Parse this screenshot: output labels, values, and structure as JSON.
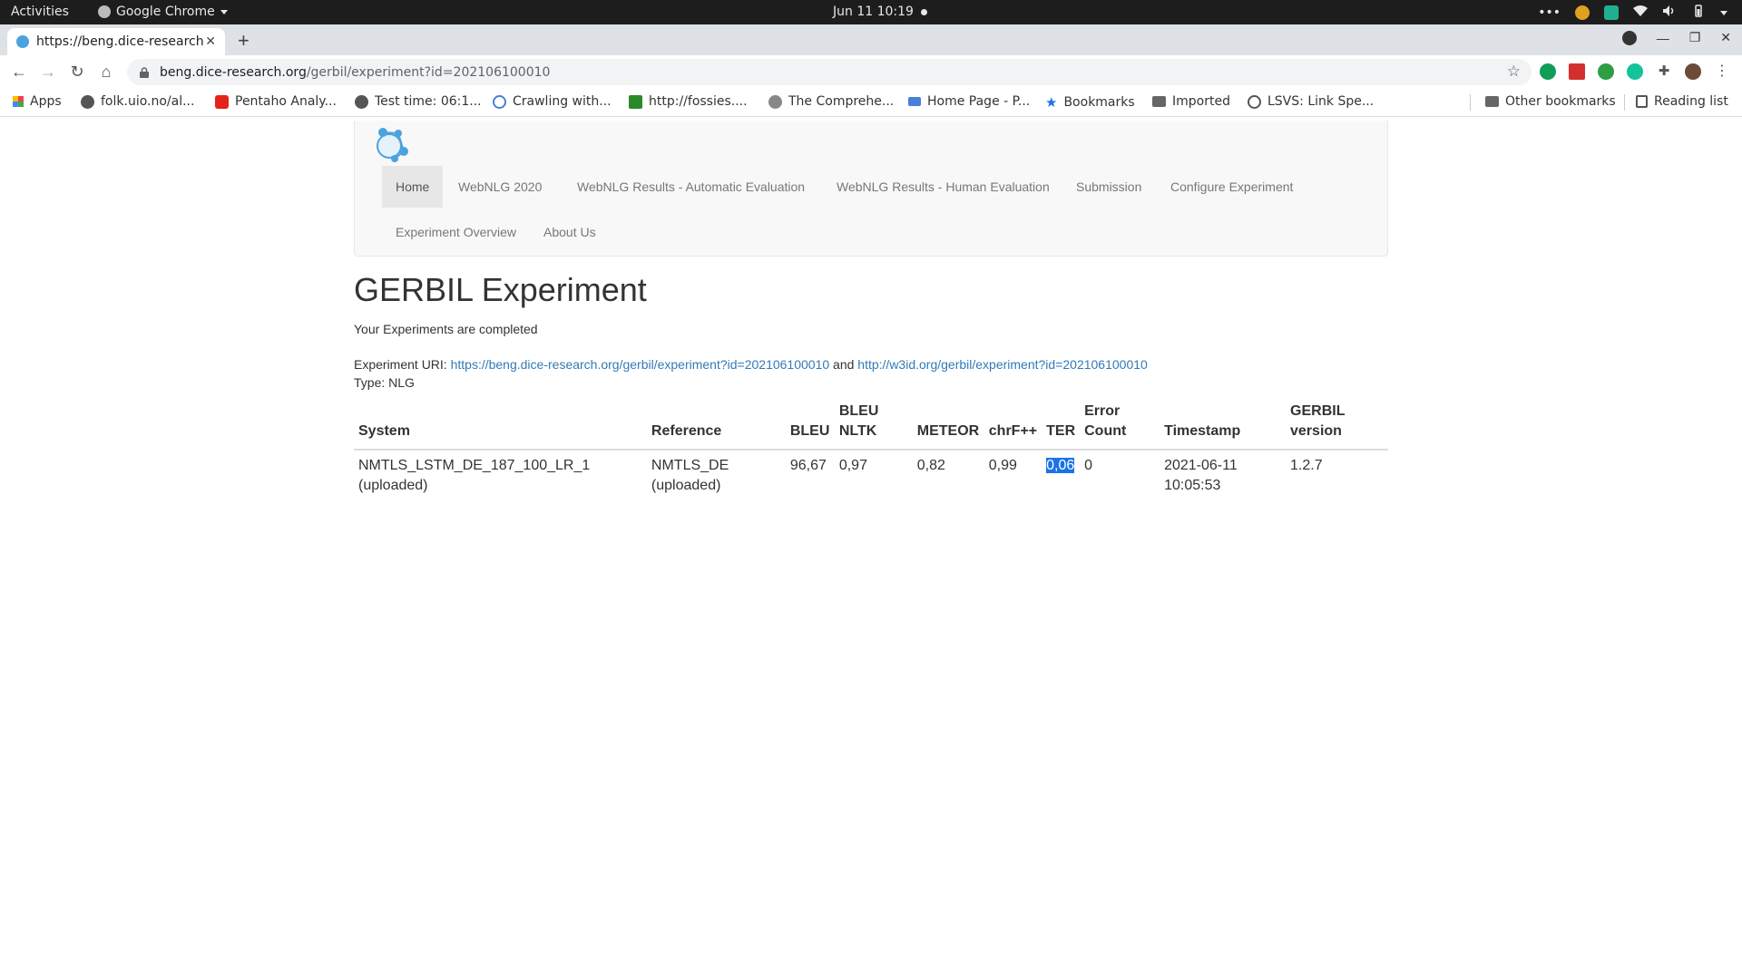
{
  "system_bar": {
    "activities": "Activities",
    "app_name": "Google Chrome",
    "datetime": "Jun 11  10:19"
  },
  "browser": {
    "tab_title": "https://beng.dice-research.org/gerbil/experiment?id=202106100010",
    "url_host": "beng.dice-research.org",
    "url_path": "/gerbil/experiment?id=202106100010",
    "bookmarks": [
      {
        "label": "Apps",
        "icon": "apps-grid-icon"
      },
      {
        "label": "folk.uio.no/al...",
        "icon": "globe-icon"
      },
      {
        "label": "Pentaho Analy...",
        "icon": "youtube-icon"
      },
      {
        "label": "Test time: 06:1...",
        "icon": "globe-icon"
      },
      {
        "label": "Crawling with...",
        "icon": "crawl-icon"
      },
      {
        "label": "http://fossies....",
        "icon": "fossies-icon"
      },
      {
        "label": "The Comprehe...",
        "icon": "r-icon"
      },
      {
        "label": "Home Page - P...",
        "icon": "pq-icon"
      },
      {
        "label": "Bookmarks",
        "icon": "star-icon"
      },
      {
        "label": "Imported",
        "icon": "folder-icon"
      },
      {
        "label": "LSVS: Link Spe...",
        "icon": "link-icon"
      }
    ],
    "other_bookmarks": "Other bookmarks",
    "reading_list": "Reading list"
  },
  "site_nav": {
    "items": [
      "Home",
      "WebNLG 2020",
      "WebNLG Results - Automatic Evaluation",
      "WebNLG Results - Human Evaluation",
      "Submission",
      "Configure Experiment",
      "Experiment Overview",
      "About Us"
    ]
  },
  "page": {
    "title": "GERBIL Experiment",
    "status": "Your Experiments are completed",
    "uri_label": "Experiment URI:",
    "uri_1": "https://beng.dice-research.org/gerbil/experiment?id=202106100010",
    "uri_and": "and",
    "uri_2": "http://w3id.org/gerbil/experiment?id=202106100010",
    "type_line": "Type: NLG"
  },
  "table": {
    "headers": [
      "System",
      "Reference",
      "BLEU",
      "BLEU NLTK",
      "METEOR",
      "chrF++",
      "TER",
      "Error Count",
      "Timestamp",
      "GERBIL version"
    ],
    "rows": [
      {
        "system": "NMTLS_LSTM_DE_187_100_LR_1 (uploaded)",
        "reference": "NMTLS_DE (uploaded)",
        "bleu": "96,67",
        "bleu_nltk": "0,97",
        "meteor": "0,82",
        "chrf": "0,99",
        "ter": "0,06",
        "error_count": "0",
        "timestamp": "2021-06-11 10:05:53",
        "gerbil_version": "1.2.7"
      }
    ]
  },
  "colors": {
    "link": "#337ab7",
    "selection": "#1a73e8"
  }
}
